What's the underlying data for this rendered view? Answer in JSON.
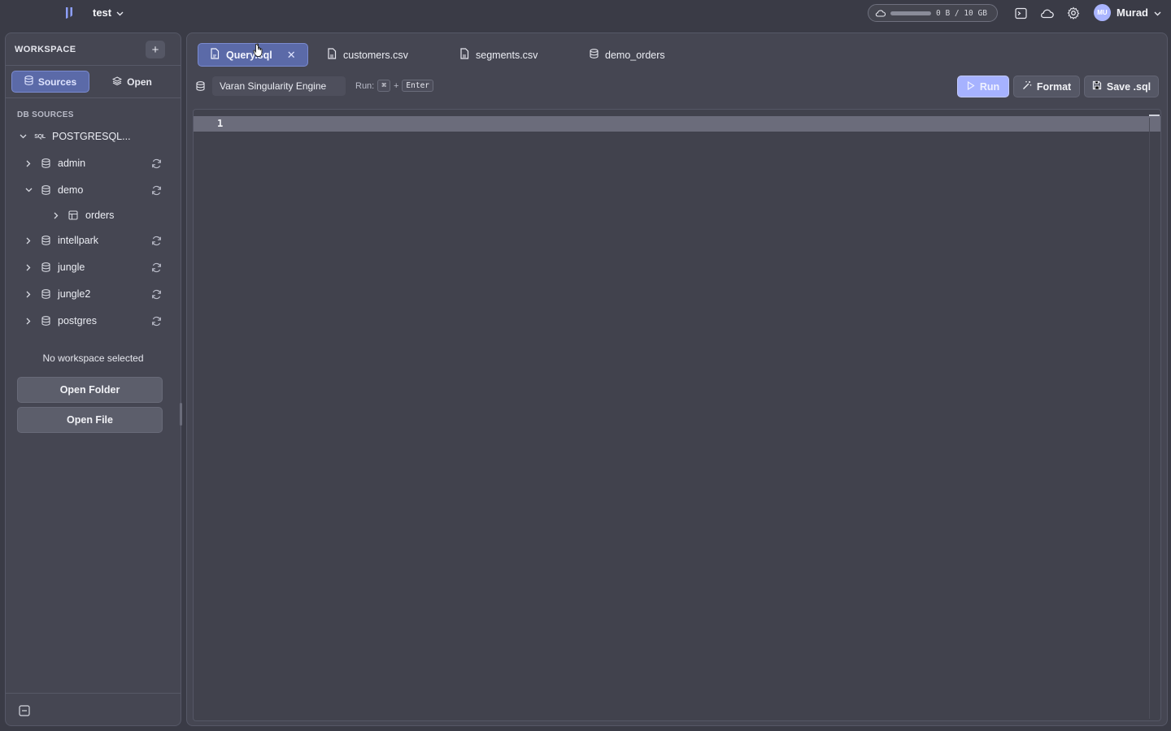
{
  "topbar": {
    "project_name": "test",
    "storage_text": "0 B / 10 GB",
    "user_initials": "MU",
    "user_name": "Murad"
  },
  "sidebar": {
    "header": "WORKSPACE",
    "add_label": "+",
    "tabs": [
      {
        "label": "Sources",
        "active": true,
        "icon": "database-icon"
      },
      {
        "label": "Open",
        "active": false,
        "icon": "layers-icon"
      }
    ],
    "section_label": "DB SOURCES",
    "connection": {
      "badge": "SQL",
      "label": "POSTGRESQL...",
      "expanded": true
    },
    "databases": [
      {
        "label": "admin",
        "expanded": false
      },
      {
        "label": "demo",
        "expanded": true,
        "tables": [
          {
            "label": "orders"
          }
        ]
      },
      {
        "label": "intellpark",
        "expanded": false
      },
      {
        "label": "jungle",
        "expanded": false
      },
      {
        "label": "jungle2",
        "expanded": false
      },
      {
        "label": "postgres",
        "expanded": false
      }
    ],
    "empty_message": "No workspace selected",
    "open_folder_label": "Open Folder",
    "open_file_label": "Open File"
  },
  "tabs": [
    {
      "label": "Query.sql",
      "active": true,
      "icon": "sql-file-icon",
      "closable": true
    },
    {
      "label": "customers.csv",
      "active": false,
      "icon": "csv-file-icon"
    },
    {
      "label": "segments.csv",
      "active": false,
      "icon": "csv-file-icon"
    },
    {
      "label": "demo_orders",
      "active": false,
      "icon": "database-icon"
    }
  ],
  "toolbar": {
    "engine": "Varan Singularity Engine",
    "run_hint_label": "Run:",
    "run_hint_key1": "⌘",
    "run_hint_plus": "+",
    "run_hint_key2": "Enter",
    "run_label": "Run",
    "format_label": "Format",
    "save_label": "Save .sql"
  },
  "editor": {
    "line_numbers": [
      "1"
    ],
    "content": ""
  },
  "colors": {
    "accent": "#5b6aa8",
    "run_button": "#a6b2ff",
    "background": "#3a3b46",
    "panel": "#454652"
  }
}
